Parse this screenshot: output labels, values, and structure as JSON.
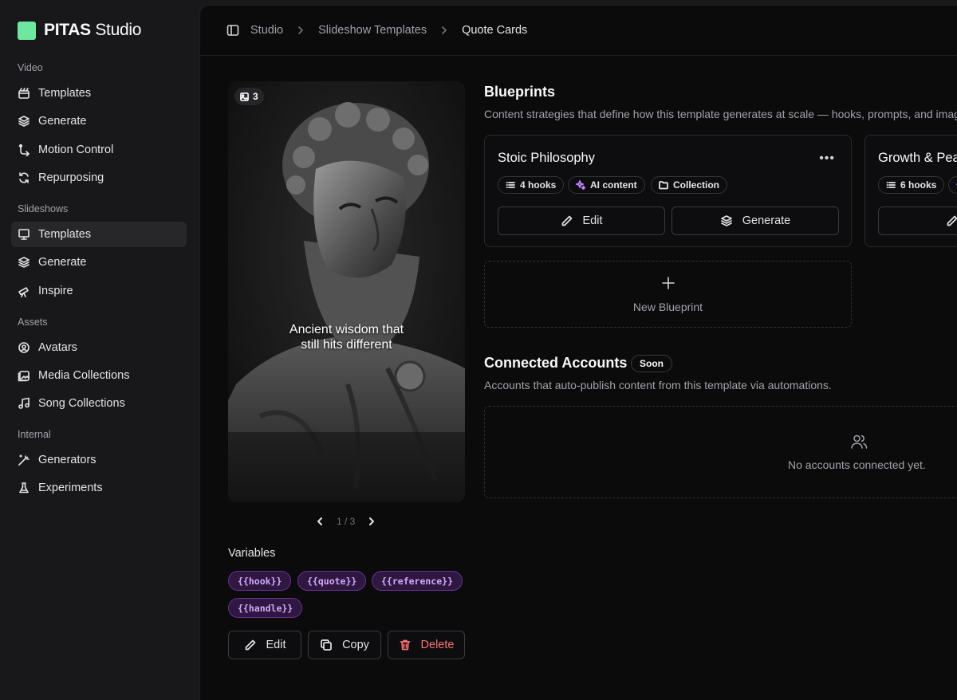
{
  "brand": {
    "name_bold": "PITAS",
    "name_light": "Studio"
  },
  "sidebar": {
    "sections": [
      {
        "label": "Video",
        "items": [
          {
            "label": "Templates",
            "icon": "clapperboard-icon"
          },
          {
            "label": "Generate",
            "icon": "layers-icon"
          },
          {
            "label": "Motion Control",
            "icon": "motion-icon"
          },
          {
            "label": "Repurposing",
            "icon": "refresh-icon"
          }
        ]
      },
      {
        "label": "Slideshows",
        "items": [
          {
            "label": "Templates",
            "icon": "presentation-icon",
            "active": true
          },
          {
            "label": "Generate",
            "icon": "layers-icon"
          },
          {
            "label": "Inspire",
            "icon": "telescope-icon"
          }
        ]
      },
      {
        "label": "Assets",
        "items": [
          {
            "label": "Avatars",
            "icon": "user-circle-icon"
          },
          {
            "label": "Media Collections",
            "icon": "images-icon"
          },
          {
            "label": "Song Collections",
            "icon": "music-icon"
          }
        ]
      },
      {
        "label": "Internal",
        "items": [
          {
            "label": "Generators",
            "icon": "wand-icon"
          },
          {
            "label": "Experiments",
            "icon": "flask-icon"
          }
        ]
      }
    ]
  },
  "breadcrumb": [
    "Studio",
    "Slideshow Templates",
    "Quote Cards"
  ],
  "preview": {
    "image_count": "3",
    "caption_line1": "Ancient wisdom that",
    "caption_line2": "still hits different",
    "pager": "1 / 3"
  },
  "variables": {
    "title": "Variables",
    "chips": [
      "{{hook}}",
      "{{quote}}",
      "{{reference}}",
      "{{handle}}"
    ]
  },
  "template_actions": {
    "edit": "Edit",
    "copy": "Copy",
    "delete": "Delete"
  },
  "blueprints": {
    "title": "Blueprints",
    "description": "Content strategies that define how this template generates at scale — hooks, prompts, and imag",
    "cards": [
      {
        "title": "Stoic Philosophy",
        "hooks": "4 hooks",
        "content": "AI content",
        "source": "Collection",
        "edit": "Edit",
        "generate": "Generate"
      },
      {
        "title": "Growth & Pea",
        "hooks": "6 hooks"
      }
    ],
    "new_label": "New Blueprint"
  },
  "connected_accounts": {
    "title": "Connected Accounts",
    "badge": "Soon",
    "description": "Accounts that auto-publish content from this template via automations.",
    "empty": "No accounts connected yet."
  },
  "colors": {
    "accent_logo": "#6ee7a1",
    "chip_text": "#d6a6ff",
    "danger": "#f87171"
  }
}
